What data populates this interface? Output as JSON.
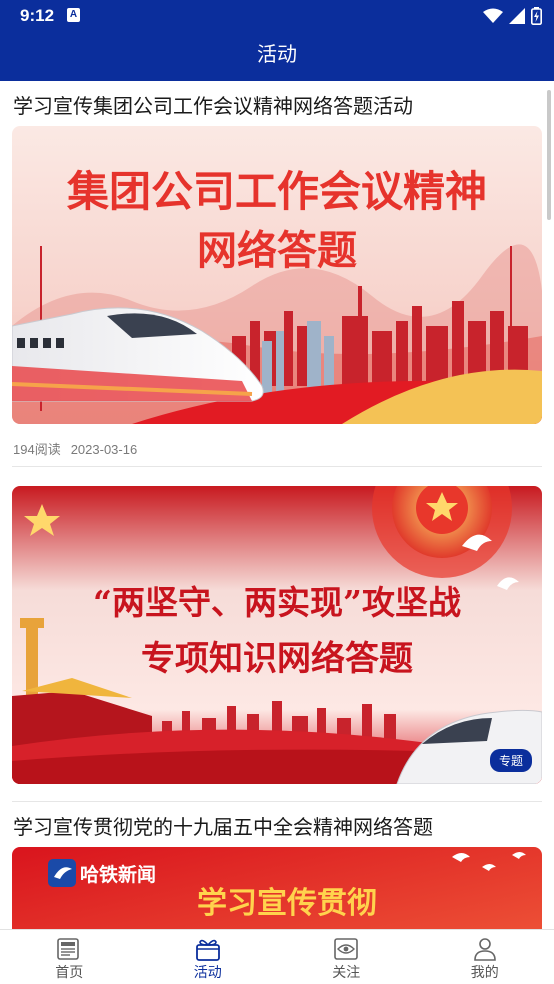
{
  "status_bar": {
    "time": "9:12",
    "notification_icon": "A"
  },
  "header": {
    "title": "活动"
  },
  "feed": [
    {
      "title": "学习宣传集团公司工作会议精神网络答题活动",
      "banner": {
        "line1": "集团公司工作会议精神",
        "line2": "网络答题"
      },
      "reads": "194阅读",
      "date": "2023-03-16"
    },
    {
      "title": "",
      "banner": {
        "line1": "“两坚守、两实现”攻坚战",
        "line2": "专项知识网络答题",
        "tag": "专题"
      }
    },
    {
      "title": "学习宣传贯彻党的十九届五中全会精神网络答题",
      "banner": {
        "logo": "哈铁新闻",
        "line1": "学习宣传贯彻"
      }
    }
  ],
  "bottom_nav": [
    {
      "label": "首页",
      "icon": "news-icon",
      "active": false
    },
    {
      "label": "活动",
      "icon": "gift-icon",
      "active": true
    },
    {
      "label": "关注",
      "icon": "eye-icon",
      "active": false
    },
    {
      "label": "我的",
      "icon": "profile-icon",
      "active": false
    }
  ],
  "colors": {
    "primary": "#0b2e9c",
    "banner_red": "#d7212a"
  }
}
